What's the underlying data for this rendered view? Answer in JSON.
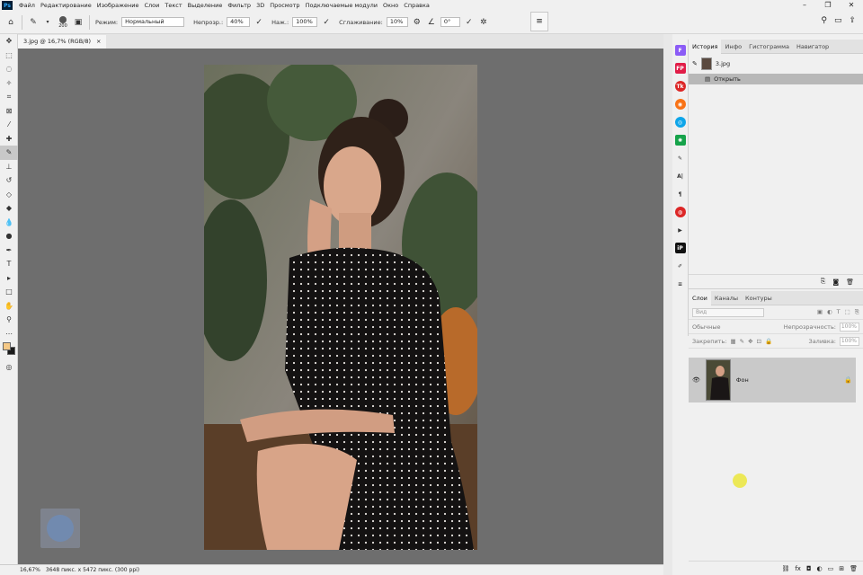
{
  "menubar": {
    "logo": "Ps",
    "items": [
      "Файл",
      "Редактирование",
      "Изображение",
      "Слои",
      "Текст",
      "Выделение",
      "Фильтр",
      "3D",
      "Просмотр",
      "Подключаемые модули",
      "Окно",
      "Справка"
    ]
  },
  "options": {
    "brush_size": "200",
    "mode_label": "Режим:",
    "mode_value": "Нормальный",
    "opacity_label": "Непрозр.:",
    "opacity_value": "40%",
    "flow_label": "Наж.:",
    "flow_value": "100%",
    "smoothing_label": "Сглаживание:",
    "smoothing_value": "10%",
    "angle_value": "0°"
  },
  "document": {
    "tab_title": "3.jpg @ 16,7% (RGB/8)",
    "tab_close": "×"
  },
  "status": {
    "zoom": "16,67%",
    "size": "3648 пикс. x 5472 пикс. (300 ppi)"
  },
  "history": {
    "tabs": [
      "История",
      "Инфо",
      "Гистограмма",
      "Навигатор"
    ],
    "snapshot_label": "3.jpg",
    "state_label": "Открыть"
  },
  "layers": {
    "tabs": [
      "Слои",
      "Каналы",
      "Контуры"
    ],
    "filter_placeholder": "Вид",
    "blend_mode": "Обычные",
    "opacity_label": "Непрозрачность:",
    "opacity_value": "100%",
    "lock_label": "Закрепить:",
    "fill_label": "Заливка:",
    "fill_value": "100%",
    "layer_name": "Фон"
  },
  "colors": {
    "foreground": "#f5c987",
    "background": "#1a1a1a",
    "canvas": "#6e6e6e"
  }
}
